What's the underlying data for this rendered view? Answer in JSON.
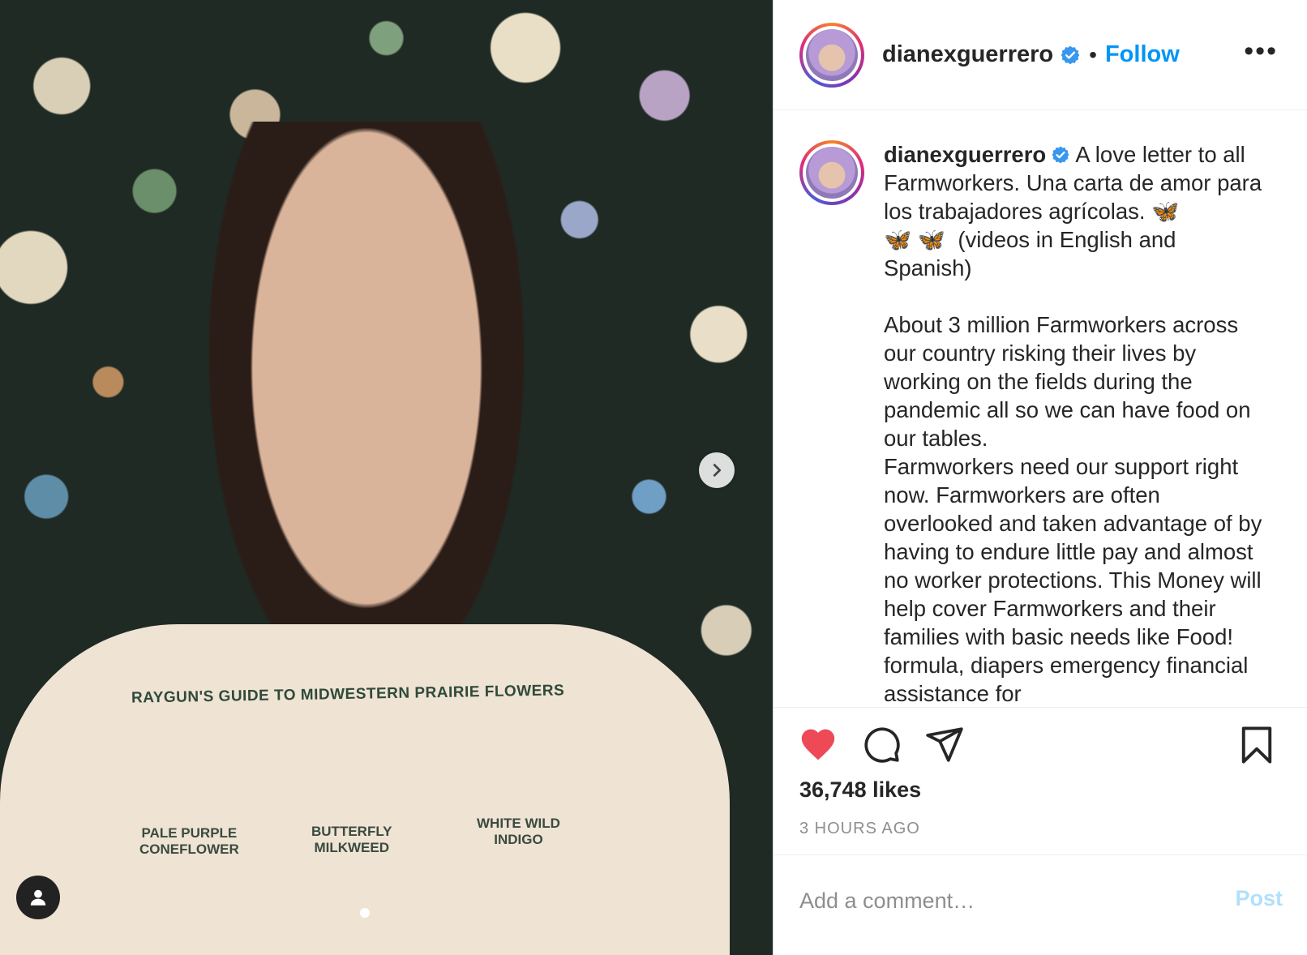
{
  "header": {
    "username": "dianexguerrero",
    "separator": "•",
    "follow_label": "Follow",
    "more_label": "•••"
  },
  "caption": {
    "username": "dianexguerrero",
    "text": " A love letter to all Farmworkers. Una carta de amor para los trabajadores agrícolas. 🦋\n🦋 🦋  (videos in English and Spanish)\n\nAbout 3 million Farmworkers across our country risking their lives by working on the fields during the pandemic all so we can have food on our tables.\nFarmworkers need our support right now. Farmworkers are often overlooked and taken advantage of by having to endure little pay and almost no worker protections. This Money will help cover Farmworkers and their families with basic needs like Food! formula, diapers emergency financial assistance for"
  },
  "media": {
    "shirt_title": "RAYGUN'S GUIDE TO MIDWESTERN PRAIRIE FLOWERS",
    "flower_labels": [
      "PALE PURPLE\nCONEFLOWER",
      "BUTTERFLY\nMILKWEED",
      "WHITE WILD\nINDIGO"
    ],
    "next_icon": "chevron-right-icon",
    "tag_icon": "user-tag-icon"
  },
  "engagement": {
    "likes": "36,748 likes",
    "time": "3 HOURS AGO"
  },
  "comment": {
    "placeholder": "Add a comment…",
    "post_label": "Post"
  },
  "colors": {
    "like": "#ed4956",
    "link": "#0095f6",
    "post_disabled": "#b2dffc",
    "verified": "#3897f0"
  }
}
